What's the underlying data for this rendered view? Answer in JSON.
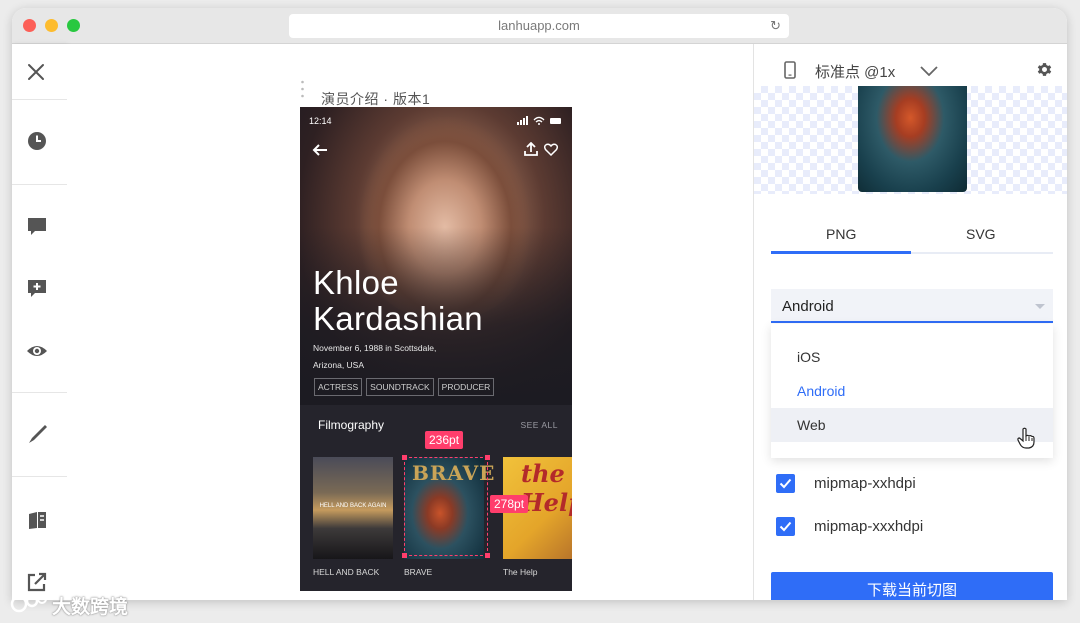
{
  "browser": {
    "url": "lanhuapp.com"
  },
  "artboard": {
    "title": "演员介绍 · 版本1"
  },
  "phone": {
    "status_time": "12:14",
    "first_name": "Khloe",
    "last_name": "Kardashian",
    "bio_line1": "November 6, 1988 in Scottsdale,",
    "bio_line2": "Arizona, USA",
    "tags": [
      "ACTRESS",
      "SOUNDTRACK",
      "PRODUCER"
    ],
    "filmography_title": "Filmography",
    "see_all": "SEE ALL",
    "poster1_overlay": "HELL AND BACK AGAIN",
    "poster2_overlay": "BRAVE",
    "poster3_overlay": "the Help",
    "captions": [
      "HELL AND BACK",
      "BRAVE",
      "The Help"
    ]
  },
  "measurements": {
    "width_label": "236pt",
    "height_label": "278pt"
  },
  "panel": {
    "scale_label": "标准点 @1x",
    "tabs": [
      "PNG",
      "SVG"
    ],
    "active_tab": "PNG",
    "platform_selected": "Android",
    "platform_options": [
      "iOS",
      "Android",
      "Web"
    ],
    "checks": [
      {
        "label": "mipmap-xxhdpi",
        "checked": true
      },
      {
        "label": "mipmap-xxxhdpi",
        "checked": true
      }
    ],
    "download_button": "下载当前切图"
  },
  "watermark": {
    "text": "大数跨境"
  },
  "colors": {
    "accent": "#2f6df7",
    "measure": "#ff3e6c",
    "phone_bg": "#1c1b22"
  }
}
